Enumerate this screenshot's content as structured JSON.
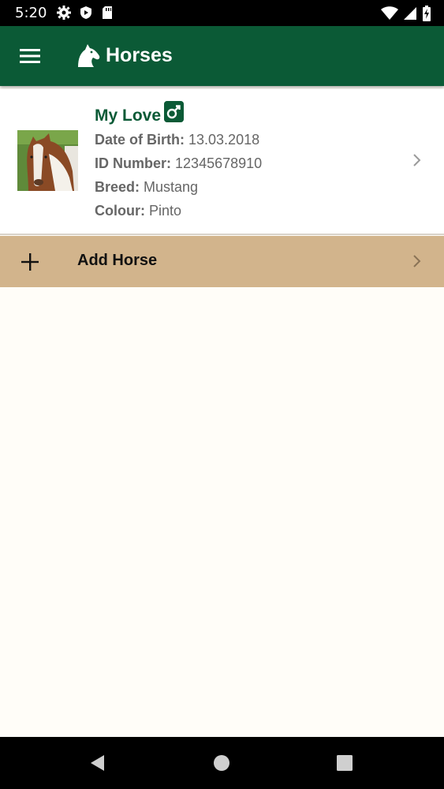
{
  "status_bar": {
    "time": "5:20"
  },
  "app_bar": {
    "title": "Horses"
  },
  "horses": [
    {
      "name": "My Love",
      "gender": "male",
      "dob_label": "Date of Birth:",
      "dob_value": "13.03.2018",
      "id_label": "ID Number:",
      "id_value": "12345678910",
      "breed_label": "Breed:",
      "breed_value": "Mustang",
      "colour_label": "Colour:",
      "colour_value": "Pinto"
    }
  ],
  "add_horse": {
    "label": "Add Horse"
  },
  "colors": {
    "primary": "#0b5a36",
    "accent": "#d2b48c",
    "background": "#fffdf8"
  }
}
